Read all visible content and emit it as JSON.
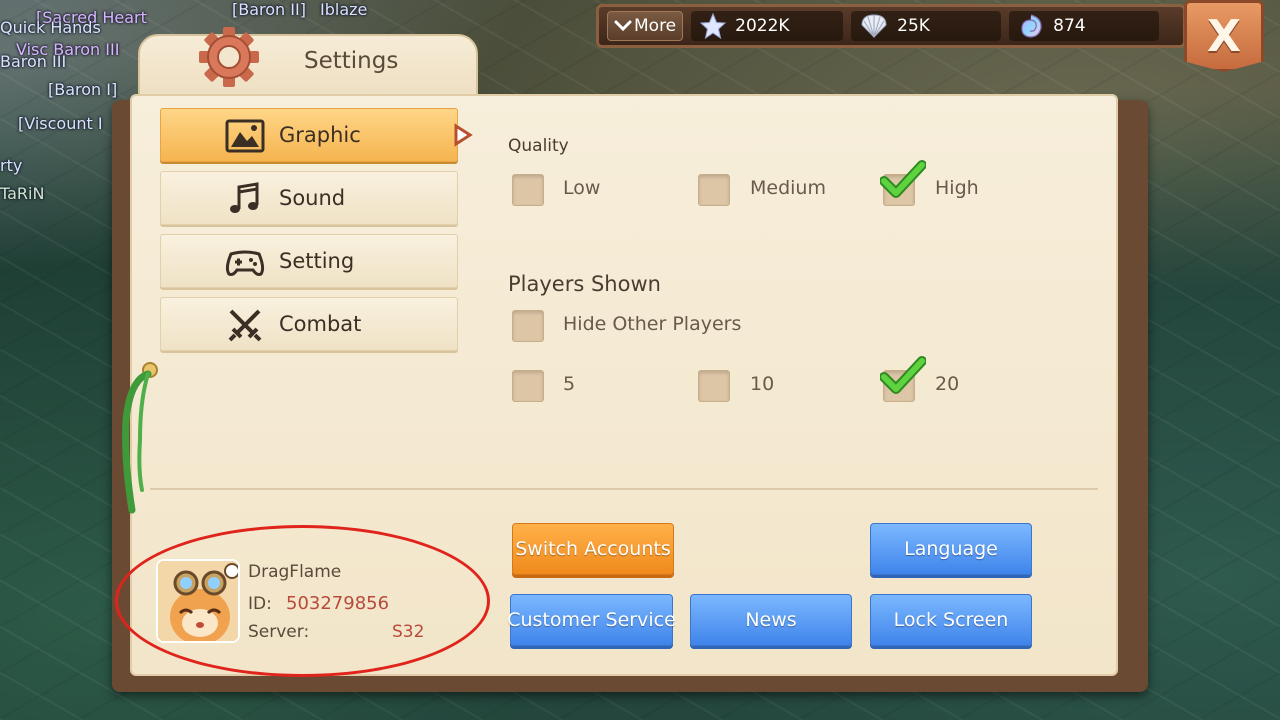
{
  "background": {
    "player_tags": [
      {
        "text": "[Sacred Heart",
        "color": "purple"
      },
      {
        "text": "Quick Hands",
        "color": "blue"
      },
      {
        "text": "[Baron II]",
        "color": "blue"
      },
      {
        "text": "Iblaze",
        "color": "blue"
      },
      {
        "text": "Visc Baron III",
        "color": "purple"
      },
      {
        "text": "Baron III",
        "color": "blue"
      },
      {
        "text": "[Baron I]",
        "color": "blue"
      },
      {
        "text": "[Viscount I",
        "color": "blue"
      },
      {
        "text": "rty",
        "color": "blue"
      },
      {
        "text": "TaRiN",
        "color": "green"
      }
    ]
  },
  "topbar": {
    "more_label": "More",
    "currencies": [
      {
        "icon": "star-icon",
        "value": "2022K"
      },
      {
        "icon": "shell-icon",
        "value": "25K"
      },
      {
        "icon": "conch-icon",
        "value": "874"
      }
    ],
    "close_label": "X"
  },
  "panel": {
    "title": "Settings",
    "menu": [
      {
        "label": "Graphic",
        "icon": "image-icon",
        "active": true
      },
      {
        "label": "Sound",
        "icon": "music-note-icon",
        "active": false
      },
      {
        "label": "Setting",
        "icon": "gamepad-icon",
        "active": false
      },
      {
        "label": "Combat",
        "icon": "crossed-swords-icon",
        "active": false
      }
    ]
  },
  "graphic": {
    "quality_label": "Quality",
    "quality_options": [
      {
        "label": "Low",
        "checked": false
      },
      {
        "label": "Medium",
        "checked": false
      },
      {
        "label": "High",
        "checked": true
      }
    ],
    "players_label": "Players Shown",
    "hide_players_label": "Hide Other Players",
    "hide_players_checked": false,
    "player_count_options": [
      {
        "label": "5",
        "checked": false
      },
      {
        "label": "10",
        "checked": false
      },
      {
        "label": "20",
        "checked": true
      }
    ]
  },
  "profile": {
    "name": "DragFlame",
    "id_label": "ID:",
    "id_value": "503279856",
    "server_label": "Server:",
    "server_value": "S32"
  },
  "actions": {
    "switch_accounts": "Switch Accounts",
    "language": "Language",
    "customer_service": "Customer Service",
    "news": "News",
    "lock_screen": "Lock Screen"
  },
  "colors": {
    "active_tab": "#f5b44f",
    "orange_button": "#f08a1c",
    "blue_button": "#3f84ea",
    "highlight_ellipse": "#e0241c",
    "check_green": "#3fbf2a"
  }
}
